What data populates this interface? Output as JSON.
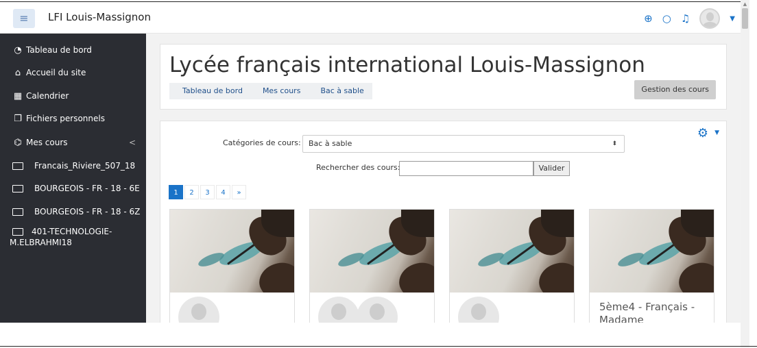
{
  "navbar": {
    "menu_icon": "hamburger-menu-icon",
    "site_name": "LFI Louis-Massignon",
    "icons": [
      "globe-icon",
      "chat-icon",
      "bell-icon",
      "user-avatar"
    ]
  },
  "sidebar": {
    "items": [
      {
        "label": "Tableau de bord",
        "icon": "dashboard-icon"
      },
      {
        "label": "Accueil du site",
        "icon": "home-icon"
      },
      {
        "label": "Calendrier",
        "icon": "calendar-icon"
      },
      {
        "label": "Fichiers personnels",
        "icon": "files-icon"
      },
      {
        "label": "Mes cours",
        "icon": "graduation-cap-icon",
        "chevron": "<"
      }
    ],
    "courses": [
      {
        "label": "Francais_Riviere_507_18"
      },
      {
        "label": "BOURGEOIS - FR - 18 - 6E"
      },
      {
        "label": "BOURGEOIS - FR - 18 - 6Z"
      },
      {
        "label": "401-TECHNOLOGIE-\nM.ELBRAHMI18"
      }
    ]
  },
  "header": {
    "title": "Lycée français international Louis-Massignon",
    "breadcrumb": [
      "Tableau de bord",
      "Mes cours",
      "Bac à sable"
    ],
    "manage_button": "Gestion des cours"
  },
  "content": {
    "category_label": "Catégories de cours:",
    "category_value": "Bac à sable",
    "search_label": "Rechercher des cours:",
    "search_value": "",
    "search_button": "Valider",
    "pagination": [
      "1",
      "2",
      "3",
      "4",
      "»"
    ],
    "active_page": "1",
    "courses": [
      {
        "title": "",
        "avatars": 1
      },
      {
        "title": "",
        "avatars": 2
      },
      {
        "title": "",
        "avatars": 1
      },
      {
        "title": "5ème4 - Français - Madame",
        "avatars": 0
      }
    ]
  },
  "colors": {
    "accent": "#1a73c8",
    "sidebar_bg": "#2b2d33",
    "page_bg": "#f2f2f2"
  }
}
